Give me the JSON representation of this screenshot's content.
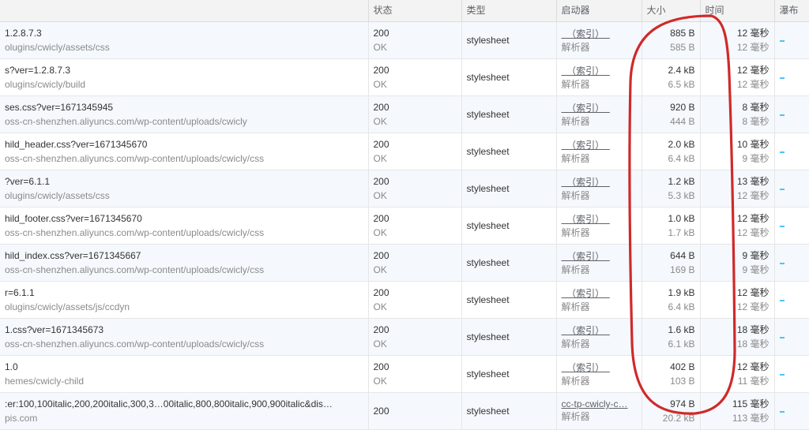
{
  "headers": {
    "name": "",
    "status": "状态",
    "type": "类型",
    "initiator": "启动器",
    "size": "大小",
    "time": "时间",
    "waterfall": "瀑布"
  },
  "initiator_labels": {
    "index": "（索引）",
    "parser": "解析器"
  },
  "rows": [
    {
      "name": "1.2.8.7.3",
      "path": "olugins/cwicly/assets/css",
      "status_code": "200",
      "status_text": "OK",
      "type": "stylesheet",
      "initiator": "index",
      "size1": "885 B",
      "size2": "585 B",
      "time1": "12 毫秒",
      "time2": "12 毫秒"
    },
    {
      "name": "s?ver=1.2.8.7.3",
      "path": "olugins/cwicly/build",
      "status_code": "200",
      "status_text": "OK",
      "type": "stylesheet",
      "initiator": "index",
      "size1": "2.4 kB",
      "size2": "6.5 kB",
      "time1": "12 毫秒",
      "time2": "12 毫秒"
    },
    {
      "name": "ses.css?ver=1671345945",
      "path": "oss-cn-shenzhen.aliyuncs.com/wp-content/uploads/cwicly",
      "status_code": "200",
      "status_text": "OK",
      "type": "stylesheet",
      "initiator": "index",
      "size1": "920 B",
      "size2": "444 B",
      "time1": "8 毫秒",
      "time2": "8 毫秒"
    },
    {
      "name": "hild_header.css?ver=1671345670",
      "path": "oss-cn-shenzhen.aliyuncs.com/wp-content/uploads/cwicly/css",
      "status_code": "200",
      "status_text": "OK",
      "type": "stylesheet",
      "initiator": "index",
      "size1": "2.0 kB",
      "size2": "6.4 kB",
      "time1": "10 毫秒",
      "time2": "9 毫秒"
    },
    {
      "name": "?ver=6.1.1",
      "path": "olugins/cwicly/assets/css",
      "status_code": "200",
      "status_text": "OK",
      "type": "stylesheet",
      "initiator": "index",
      "size1": "1.2 kB",
      "size2": "5.3 kB",
      "time1": "13 毫秒",
      "time2": "12 毫秒"
    },
    {
      "name": "hild_footer.css?ver=1671345670",
      "path": "oss-cn-shenzhen.aliyuncs.com/wp-content/uploads/cwicly/css",
      "status_code": "200",
      "status_text": "OK",
      "type": "stylesheet",
      "initiator": "index",
      "size1": "1.0 kB",
      "size2": "1.7 kB",
      "time1": "12 毫秒",
      "time2": "12 毫秒"
    },
    {
      "name": "hild_index.css?ver=1671345667",
      "path": "oss-cn-shenzhen.aliyuncs.com/wp-content/uploads/cwicly/css",
      "status_code": "200",
      "status_text": "OK",
      "type": "stylesheet",
      "initiator": "index",
      "size1": "644 B",
      "size2": "169 B",
      "time1": "9 毫秒",
      "time2": "9 毫秒"
    },
    {
      "name": "r=6.1.1",
      "path": "olugins/cwicly/assets/js/ccdyn",
      "status_code": "200",
      "status_text": "OK",
      "type": "stylesheet",
      "initiator": "index",
      "size1": "1.9 kB",
      "size2": "6.4 kB",
      "time1": "12 毫秒",
      "time2": "12 毫秒"
    },
    {
      "name": "1.css?ver=1671345673",
      "path": "oss-cn-shenzhen.aliyuncs.com/wp-content/uploads/cwicly/css",
      "status_code": "200",
      "status_text": "OK",
      "type": "stylesheet",
      "initiator": "index",
      "size1": "1.6 kB",
      "size2": "6.1 kB",
      "time1": "18 毫秒",
      "time2": "18 毫秒"
    },
    {
      "name": "1.0",
      "path": "hemes/cwicly-child",
      "status_code": "200",
      "status_text": "OK",
      "type": "stylesheet",
      "initiator": "index",
      "size1": "402 B",
      "size2": "103 B",
      "time1": "12 毫秒",
      "time2": "11 毫秒"
    },
    {
      "name": ":er:100,100italic,200,200italic,300,3…00italic,800,800italic,900,900italic&dis…",
      "path": "pis.com",
      "status_code": "200",
      "status_text": "",
      "type": "stylesheet",
      "initiator": "cc-tp-cwicly-c…",
      "size1": "974 B",
      "size2": "20.2 kB",
      "time1": "115 毫秒",
      "time2": "113 毫秒"
    }
  ]
}
